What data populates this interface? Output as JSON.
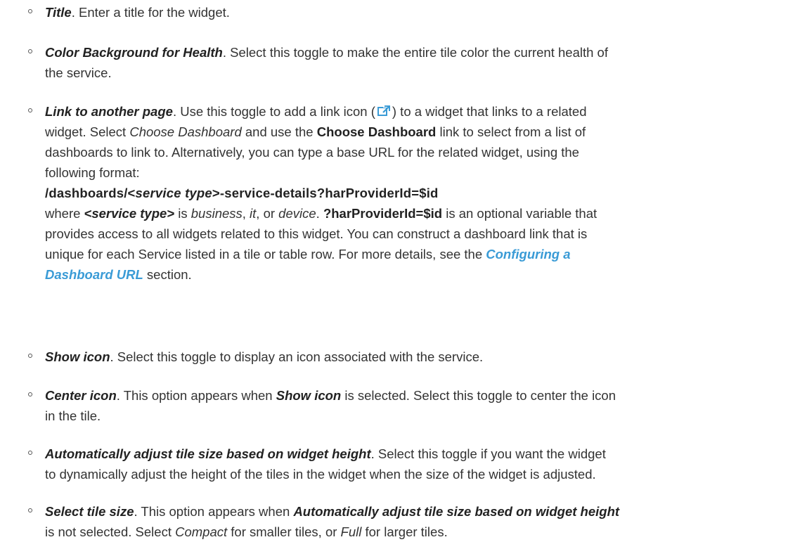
{
  "items": [
    {
      "term": "Title",
      "text": ". Enter a title for the widget."
    },
    {
      "term": "Color Background for Health",
      "text_l1": ". Select this toggle to make the entire tile color the current health of",
      "text_l2": "the service."
    },
    {
      "term": "Link to another page",
      "t1": ". Use this toggle to add a link icon (",
      "t2": ") to a widget that links to a related",
      "t3": "widget. Select ",
      "t3_em": "Choose Dashboard",
      "t3_b": " and use the ",
      "t3_strong": "Choose Dashboard",
      "t3_c": " link to select from a list of",
      "t4": "dashboards to link to. Alternatively, you can type a base URL for the related widget, using the",
      "t5": "following format:",
      "code_a": "/dashboards/<",
      "code_em": "service type",
      "code_b": ">-service-details?harProviderId=$id",
      "t7_a": "where ",
      "t7_strong": "<service type>",
      "t7_b": " is ",
      "t7_em1": "business",
      "t7_c": ", ",
      "t7_em2": "it",
      "t7_d": ", or ",
      "t7_em3": "device",
      "t7_e": ". ",
      "t7_strong2": "?harProviderId=$id",
      "t7_f": " is an optional variable that",
      "t8": "provides access to all widgets related to this widget. You can construct a dashboard link that is",
      "t9": "unique for each Service listed in a tile or table row. For more details, see the ",
      "link1": "Configuring a",
      "link2": "Dashboard URL",
      "t10": " section."
    },
    {
      "term": "Show icon",
      "text": ". Select this toggle to display an icon associated with the service."
    },
    {
      "term": "Center icon",
      "t1": ". This option appears when ",
      "t1_term": "Show icon",
      "t1_b": " is selected. Select this toggle to center the icon",
      "t2": "in the tile."
    },
    {
      "term": "Automatically adjust tile size based on widget height",
      "t1": ". Select this toggle if you want the widget",
      "t2": "to dynamically adjust the height of the tiles in the widget when the size of the widget is adjusted."
    },
    {
      "term": "Select tile size",
      "t1": ". This option appears when ",
      "t1_term": "Automatically adjust tile size based on widget height",
      "t2_a": "is not selected. Select ",
      "t2_em1": "Compact",
      "t2_b": " for smaller tiles, or ",
      "t2_em2": "Full",
      "t2_c": " for larger tiles."
    }
  ],
  "icons": {
    "bullet": "hollow-circle-bullet",
    "link": "external-link-icon",
    "link_color": "#3a9bd6"
  }
}
